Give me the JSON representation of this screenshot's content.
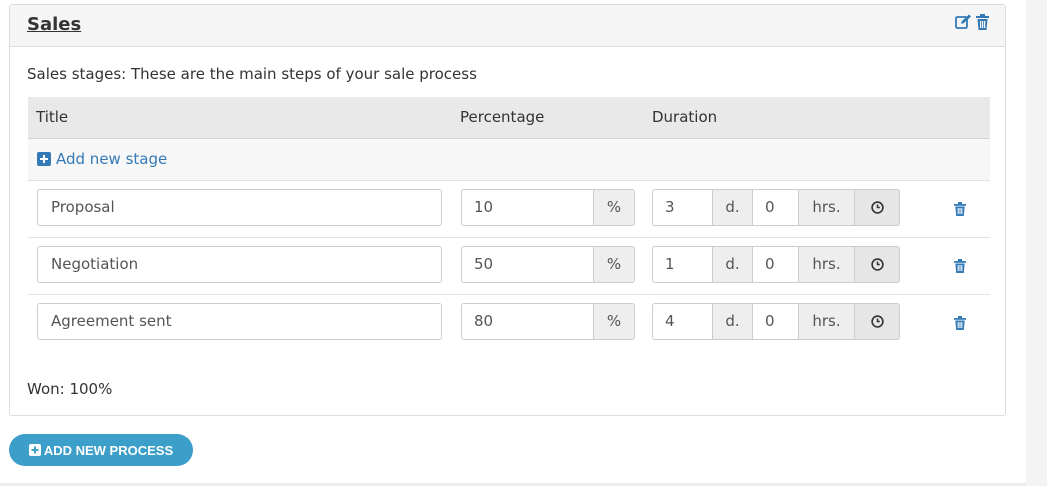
{
  "panel": {
    "title": "Sales",
    "description": "Sales stages: These are the main steps of your sale process",
    "won_text": "Won: 100%",
    "header_icons": [
      "edit-icon",
      "trash-icon"
    ]
  },
  "table": {
    "headers": {
      "title": "Title",
      "percentage": "Percentage",
      "duration": "Duration"
    },
    "add_stage_label": "Add new stage"
  },
  "stages": [
    {
      "title": "Proposal",
      "percentage": "10",
      "pct_unit": "%",
      "days": "3",
      "days_unit": "d.",
      "hours": "0",
      "hours_unit": "hrs."
    },
    {
      "title": "Negotiation",
      "percentage": "50",
      "pct_unit": "%",
      "days": "1",
      "days_unit": "d.",
      "hours": "0",
      "hours_unit": "hrs."
    },
    {
      "title": "Agreement sent",
      "percentage": "80",
      "pct_unit": "%",
      "days": "4",
      "days_unit": "d.",
      "hours": "0",
      "hours_unit": "hrs."
    }
  ],
  "add_process_label": "ADD NEW PROCESS",
  "colors": {
    "link": "#337ab7",
    "button": "#3c9fc9",
    "trash": "#337ab7"
  }
}
